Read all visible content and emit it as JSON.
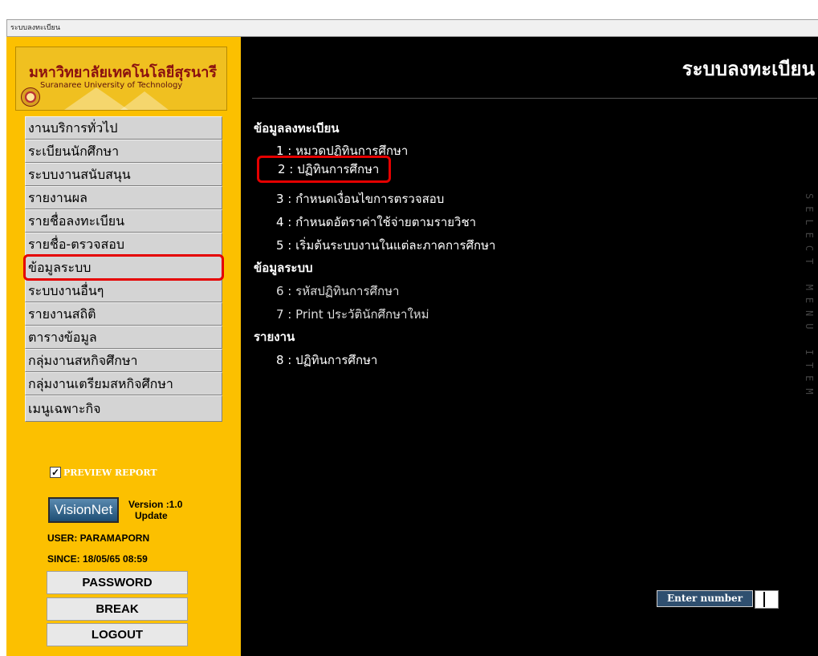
{
  "window": {
    "title": "ระบบลงทะเบียน"
  },
  "logo": {
    "thai_name": "มหาวิทยาลัยเทคโนโลยีสุรนารี",
    "english_name": "Suranaree University of Technology"
  },
  "menu": {
    "items": [
      {
        "label": "งานบริการทั่วไป"
      },
      {
        "label": "ระเบียนนักศึกษา"
      },
      {
        "label": "ระบบงานสนับสนุน"
      },
      {
        "label": "รายงานผล"
      },
      {
        "label": "รายชื่อลงทะเบียน"
      },
      {
        "label": "รายชื่อ-ตรวจสอบ"
      },
      {
        "label": "ข้อมูลระบบ"
      },
      {
        "label": "ระบบงานอื่นๆ"
      },
      {
        "label": "รายงานสถิติ"
      },
      {
        "label": "ตารางข้อมูล"
      },
      {
        "label": "กลุ่มงานสหกิจศึกษา"
      },
      {
        "label": "กลุ่มงานเตรียมสหกิจศึกษา"
      },
      {
        "label": "เมนูเฉพาะกิจ"
      }
    ],
    "selected_label": "ข้อมูลระบบ"
  },
  "preview": {
    "label": "PREVIEW REPORT",
    "checked": true,
    "check_mark": "✓"
  },
  "vision": {
    "brand": "VisionNet",
    "version_line": "Version :1.0",
    "update_line": "Update"
  },
  "user": {
    "user_text": "USER: PARAMAPORN",
    "since_text": "SINCE: 18/05/65 08:59"
  },
  "buttons": {
    "password": "PASSWORD",
    "break": "BREAK",
    "logout": "LOGOUT"
  },
  "main": {
    "heading": "ระบบลงทะเบียน",
    "sections": [
      {
        "title": "ข้อมูลลงทะเบียน",
        "options": [
          "1 : หมวดปฏิทินการศึกษา",
          "2 : ปฏิทินการศึกษา",
          "3 : กำหนดเงื่อนไขการตรวจสอบ",
          "4 : กำหนดอัตราค่าใช้จ่ายตามรายวิชา",
          "5 : เริ่มต้นระบบงานในแต่ละภาคการศึกษา"
        ]
      },
      {
        "title": "ข้อมูลระบบ",
        "options": [
          "6 : รหัสปฏิทินการศึกษา",
          "7 : Print ประวัตินักศึกษาใหม่"
        ]
      },
      {
        "title": "รายงาน",
        "options": [
          "8 : ปฏิทินการศึกษา"
        ]
      }
    ],
    "highlighted_option": "2 : ปฏิทินการศึกษา",
    "vertical_text": "SELECT MENU ITEM",
    "enter_label": "Enter number",
    "enter_value": ""
  },
  "colors": {
    "sidebar_bg": "#fcc000",
    "main_bg": "#000000",
    "highlight": "#e50000",
    "enter_label_bg": "#2f4f6f"
  }
}
